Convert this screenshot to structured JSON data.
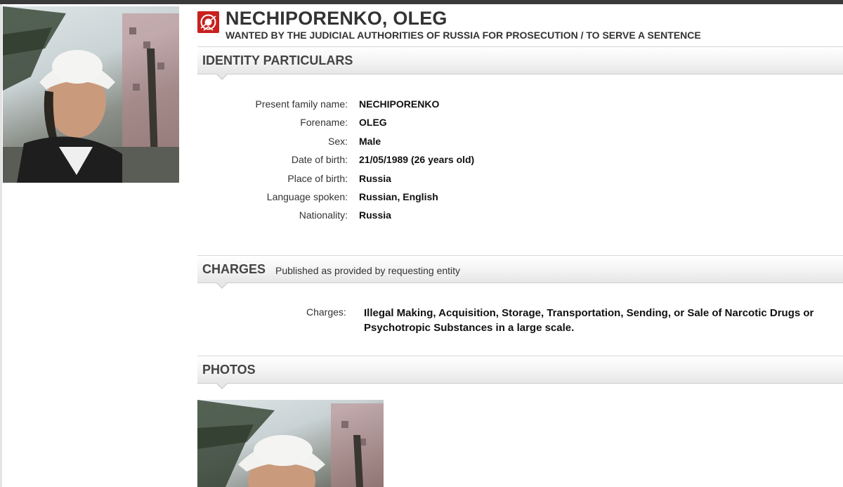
{
  "notice": {
    "name": "NECHIPORENKO, OLEG",
    "subtitle": "WANTED BY THE JUDICIAL AUTHORITIES OF RUSSIA FOR PROSECUTION / TO SERVE A SENTENCE",
    "logo_icon": "interpol-emblem-icon",
    "accent_color": "#c8211f"
  },
  "identity": {
    "heading": "IDENTITY PARTICULARS",
    "fields": [
      {
        "label": "Present family name:",
        "value": "NECHIPORENKO"
      },
      {
        "label": "Forename:",
        "value": "OLEG"
      },
      {
        "label": "Sex:",
        "value": "Male"
      },
      {
        "label": "Date of birth:",
        "value": "21/05/1989 (26 years old)"
      },
      {
        "label": "Place of birth:",
        "value": "Russia"
      },
      {
        "label": "Language spoken:",
        "value": "Russian, English"
      },
      {
        "label": "Nationality:",
        "value": "Russia"
      }
    ]
  },
  "charges": {
    "heading": "CHARGES",
    "note": "Published as provided by requesting entity",
    "label": "Charges:",
    "value": "Illegal Making, Acquisition, Storage, Transportation, Sending, or Sale of Narcotic Drugs or Psychotropic Substances in a large scale."
  },
  "photos": {
    "heading": "PHOTOS"
  }
}
